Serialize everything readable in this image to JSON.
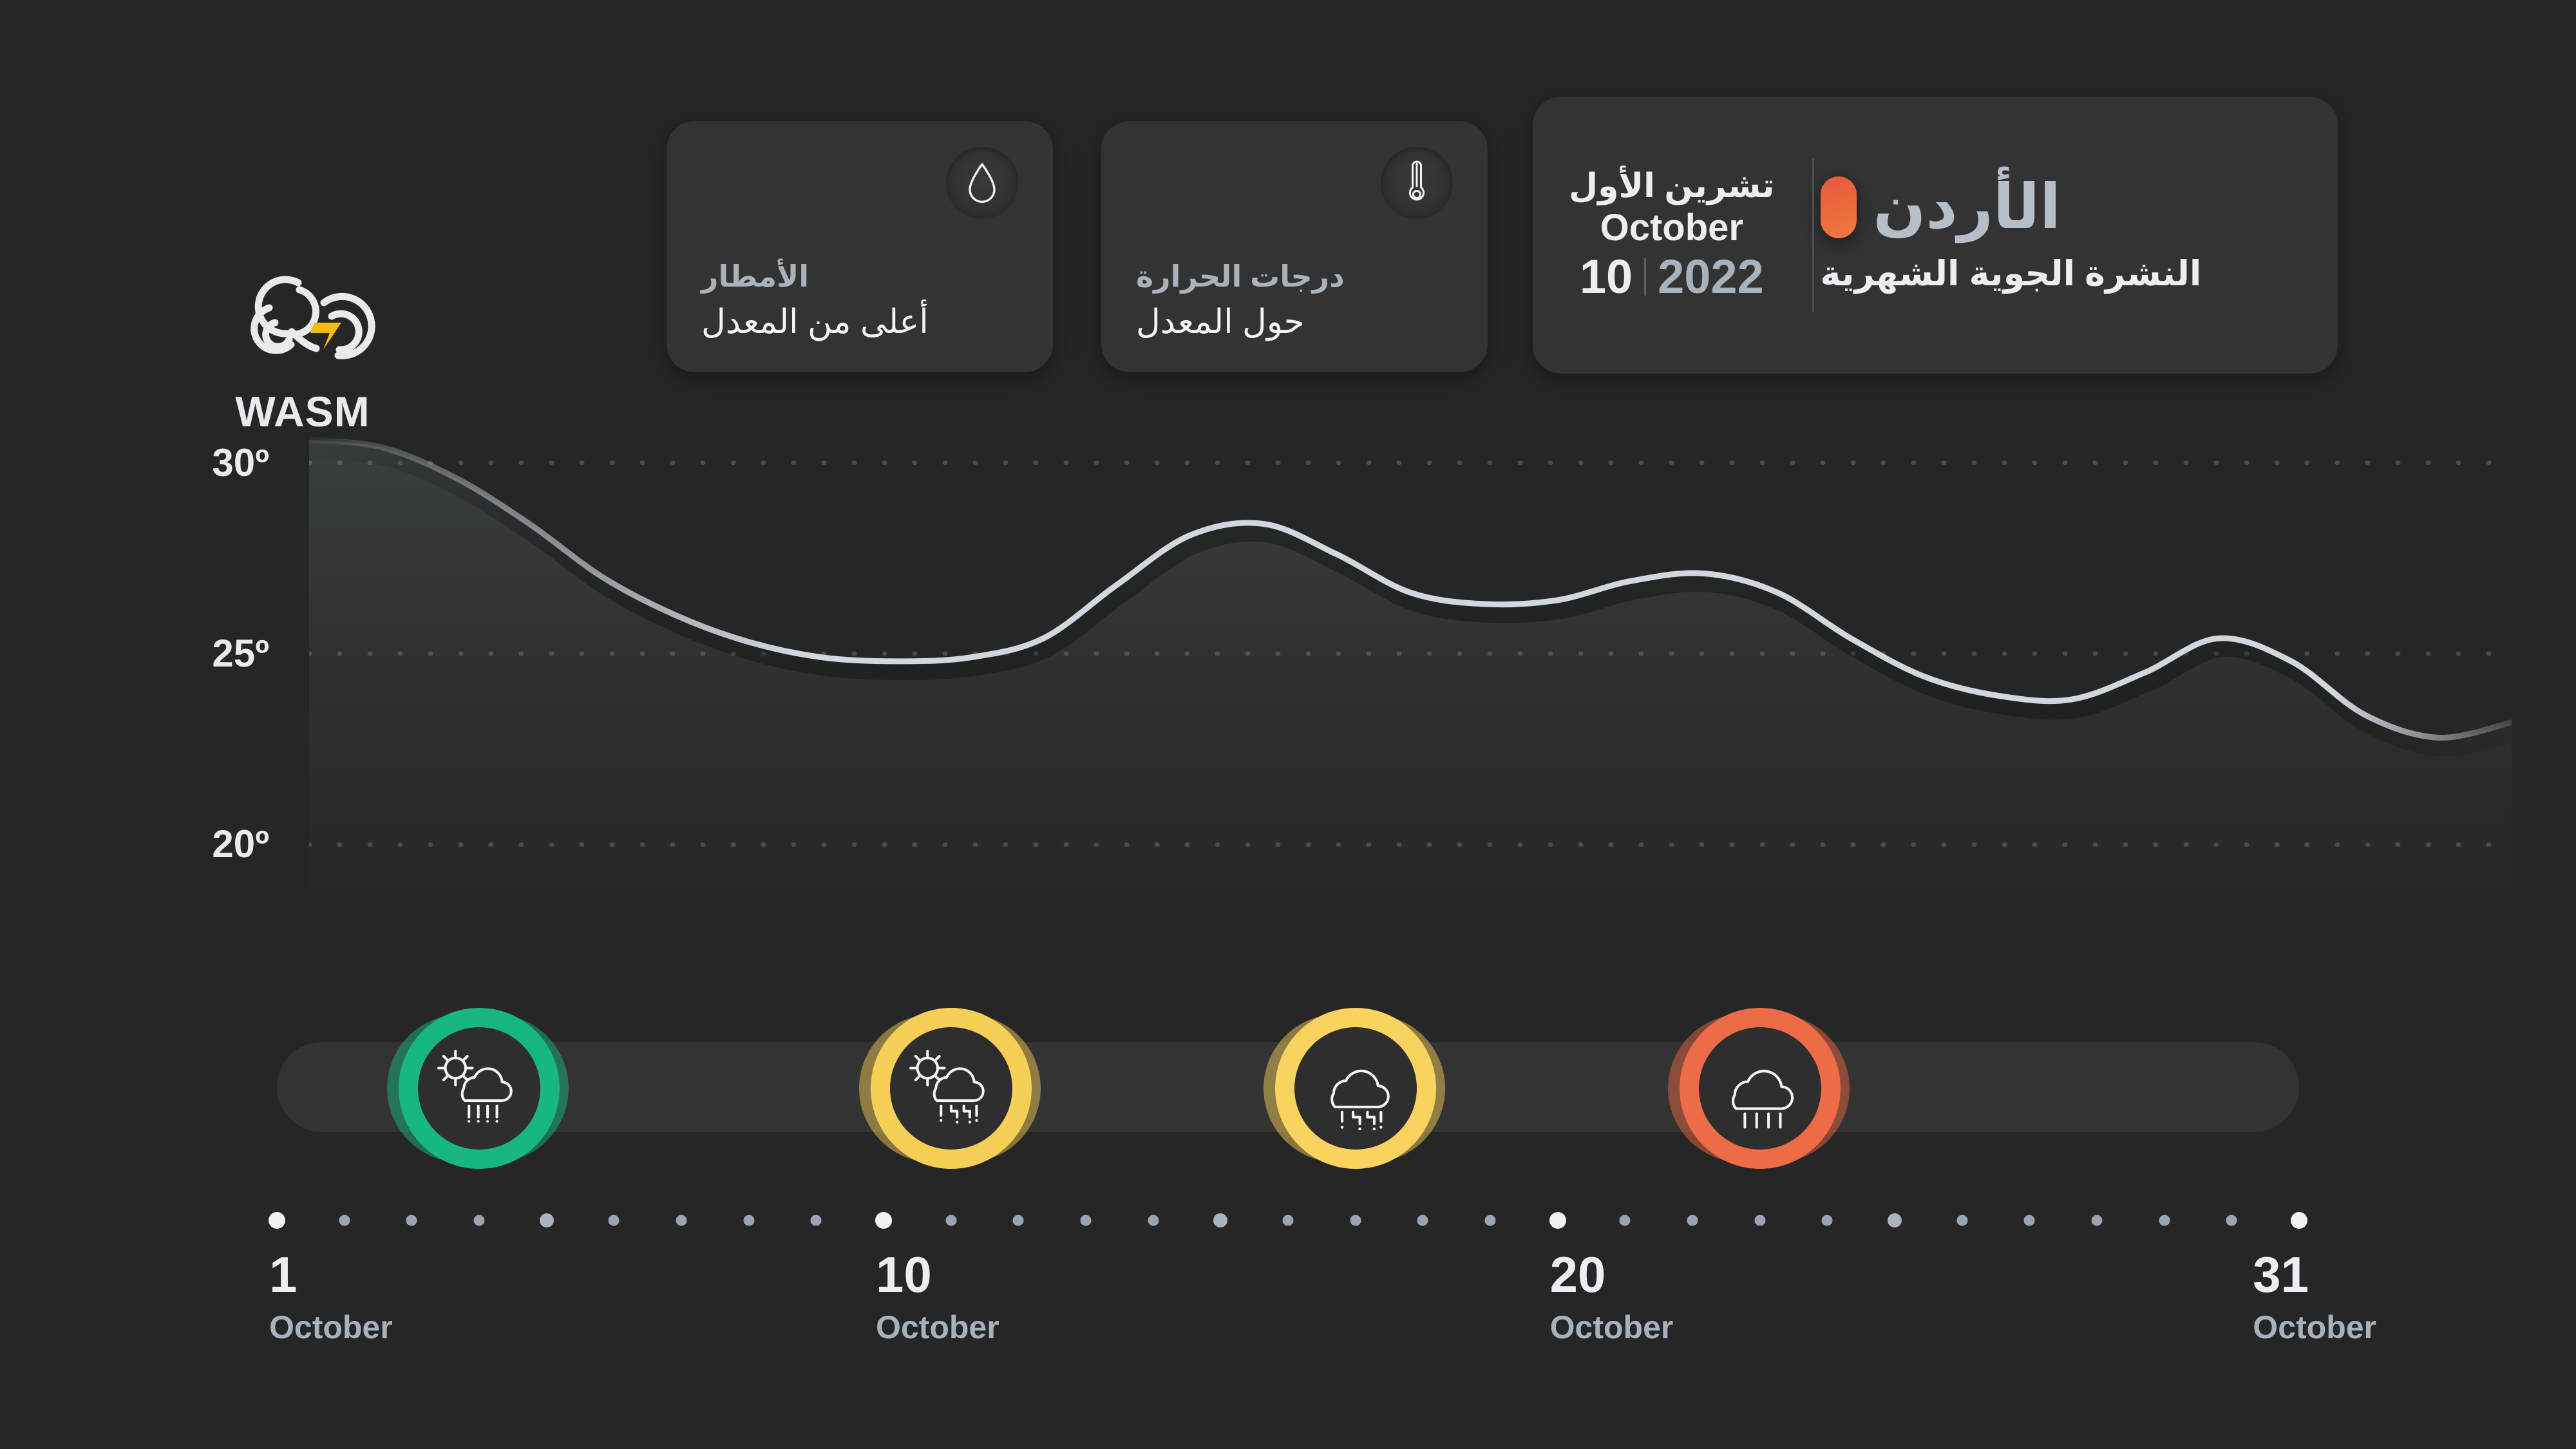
{
  "brand": {
    "name": "WASM",
    "logo_icon": "cloud-swirl-lightning-logo"
  },
  "header": {
    "country": "الأردن",
    "flag_icon": "jordan-flag-pill",
    "bulletin_title": "النشرة الجوية الشهرية",
    "month_ar": "تشرين الأول",
    "month_en": "October",
    "day": "10",
    "year": "2022",
    "accent_color": "#ee7040"
  },
  "metrics": [
    {
      "id": "temperature",
      "icon": "thermometer-icon",
      "label": "درجات الحرارة",
      "value": "حول المعدل"
    },
    {
      "id": "rainfall",
      "icon": "water-drop-icon",
      "label": "الأمطار",
      "value": "أعلى من المعدل"
    }
  ],
  "chart_data": {
    "type": "line",
    "title": "",
    "xlabel": "October",
    "ylabel": "",
    "ylim": [
      18,
      32
    ],
    "xlim": [
      1,
      31
    ],
    "grid": true,
    "legend": "none",
    "line_color": "#c9ced6",
    "fill_color": "rgba(150,175,175,0.10)",
    "ytick_labels": [
      "30º",
      "25º",
      "20º"
    ],
    "ytick_values": [
      30,
      25,
      20
    ],
    "x": [
      1,
      2,
      3,
      4,
      5,
      6,
      7,
      8,
      9,
      10,
      11,
      12,
      13,
      14,
      15,
      16,
      17,
      18,
      19,
      20,
      21,
      22,
      23,
      24,
      25,
      26,
      27,
      28,
      29,
      30,
      31
    ],
    "values": [
      30.6,
      30.4,
      29.6,
      28.4,
      27.0,
      26.0,
      25.3,
      24.9,
      24.8,
      24.9,
      25.4,
      26.8,
      28.1,
      28.4,
      27.6,
      26.6,
      26.3,
      26.4,
      26.9,
      27.1,
      26.6,
      25.4,
      24.4,
      23.9,
      23.8,
      24.5,
      25.4,
      24.8,
      23.4,
      22.8,
      23.2
    ],
    "xtick_labels": [
      "1",
      "10",
      "20",
      "31"
    ],
    "xtick_values": [
      1,
      10,
      20,
      31
    ]
  },
  "timeline": {
    "day_count": 31,
    "markers": [
      {
        "day": 4,
        "icon": "sun-cloud-rain-icon",
        "color": "#18b77e",
        "color_soft": "#1aa77a"
      },
      {
        "day": 11,
        "icon": "sun-cloud-sleet-icon",
        "color": "#f6cf57",
        "color_soft": "#d9b84e"
      },
      {
        "day": 17,
        "icon": "cloud-sleet-icon",
        "color": "#f8d35f",
        "color_soft": "#dcbb52"
      },
      {
        "day": 23,
        "icon": "cloud-rain-icon",
        "color": "#ed6b47",
        "color_soft": "#d46040"
      }
    ],
    "highlight_days": [
      1,
      10,
      20,
      31
    ],
    "medium_days": [
      5,
      15,
      25
    ]
  },
  "date_labels": [
    {
      "num": "1",
      "month": "October"
    },
    {
      "num": "10",
      "month": "October"
    },
    {
      "num": "20",
      "month": "October"
    },
    {
      "num": "31",
      "month": "October"
    }
  ]
}
